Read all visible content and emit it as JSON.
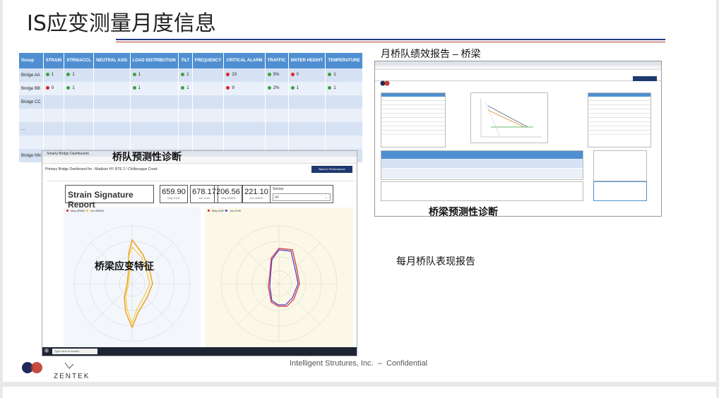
{
  "title": "IS应变测量月度信息",
  "status_table": {
    "headers": [
      "Group",
      "STRAIN",
      "STRN/ACCL",
      "NEUTRAL AXIS",
      "LOAD DISTRIBUTION",
      "TILT",
      "FREQUENCY",
      "CRITICAL ALARM",
      "TRAFFIC",
      "WATER HEIGHT",
      "TEMPERATURE"
    ],
    "rows": [
      {
        "group": "Bridge AA",
        "strain": "1",
        "strn_accl": "1",
        "neutral": "",
        "load": "1",
        "tilt": "1",
        "frequency": "",
        "alarm": "23",
        "traffic": "5%",
        "water": "0",
        "temperature": "1"
      },
      {
        "group": "Bridge BB",
        "strain": "0",
        "strn_accl": "1",
        "neutral": "",
        "load": "1",
        "tilt": "1",
        "frequency": "",
        "alarm": "9",
        "traffic": "2%",
        "water": "1",
        "temperature": "1"
      },
      {
        "group": "Bridge CC"
      },
      {
        "group": ""
      },
      {
        "group": "..."
      },
      {
        "group": ""
      },
      {
        "group": "Bridge NN"
      }
    ]
  },
  "captions": {
    "right_title": "月桥队绩效报告 – 桥梁",
    "fleet_diag": "桥队预测性诊断",
    "bridge_diag": "桥梁预测性诊断",
    "strain_signature": "桥梁应变特征",
    "monthly_report": "每月桥队表现报告"
  },
  "left_screenshot": {
    "tab": "Smarty Bridge Dashboards",
    "header": "Primary Bridge Dashboard for : Madison HY RTE 2 / Chillisnague Creek",
    "button": "Back to Performance Configuration",
    "report_title": "Strain Signature Report",
    "metrics": [
      {
        "value": "659.90",
        "label": "May #100"
      },
      {
        "value": "678.17",
        "label": "Jun #100"
      },
      {
        "value": "206.56",
        "label": "May #R600"
      },
      {
        "value": "221.10",
        "label": "Jun #R600"
      }
    ],
    "sensor_label": "Sensor",
    "sensor_value": "All",
    "legend_left": [
      "May #R600",
      "Jun #R600"
    ],
    "legend_right": [
      "May #100",
      "Jun #100"
    ],
    "taskbar_search": "Type here to search"
  },
  "colors": {
    "header_blue": "#4f8fd1",
    "row_dark": "#d6e2f3",
    "row_light": "#eaf0f9",
    "ok_green": "#3aa33a",
    "alarm_red": "#dd2222",
    "rule_blue": "#1f3a8a",
    "rule_red": "#c0392b"
  },
  "footer": {
    "company": "Intelligent Strutures, Inc.",
    "separator": "–",
    "confidential": "Confidential",
    "logo_text": "INTELLIGENT STRUCTURES",
    "zentek": "ZENTEK"
  }
}
